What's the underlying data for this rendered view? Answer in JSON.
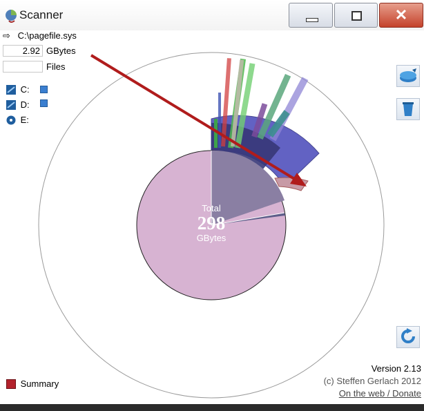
{
  "window": {
    "title": "Scanner",
    "app_icon": "scanner-app-icon",
    "controls": [
      "minimize-icon",
      "maximize-icon",
      "close-icon"
    ],
    "close_glyph": "✕"
  },
  "selection": {
    "arrow_icon": "right-arrow-icon",
    "path": "C:\\pagefile.sys",
    "size_value": "2.92",
    "size_unit": "GBytes",
    "files_value": "",
    "files_label": "Files"
  },
  "drives": [
    {
      "label": "C:",
      "icon": "hard-drive-icon"
    },
    {
      "label": "D:",
      "icon": "hard-drive-icon"
    },
    {
      "label": "E:",
      "icon": "optical-drive-icon"
    }
  ],
  "side_tools": [
    "disk-cleanup-icon",
    "recycle-bin-icon",
    "refresh-icon"
  ],
  "chart": {
    "total_label": "Total",
    "total_value": "298",
    "total_unit": "GBytes",
    "colors": {
      "ring_free": "#ffffff",
      "inner_used_pink": "#d7b3d2",
      "inner_dark_slice": "#8a7fa3",
      "outer_blue": "#5a5ac0",
      "outer_green": "#4fb84f",
      "outer_red": "#c05050",
      "annotation_arrow": "#b01c1c"
    }
  },
  "footer": {
    "summary_label": "Summary",
    "summary_icon": "summary-icon",
    "version": "Version 2.13",
    "copyright": "(c) Steffen Gerlach 2012",
    "link": "On the web / Donate"
  }
}
